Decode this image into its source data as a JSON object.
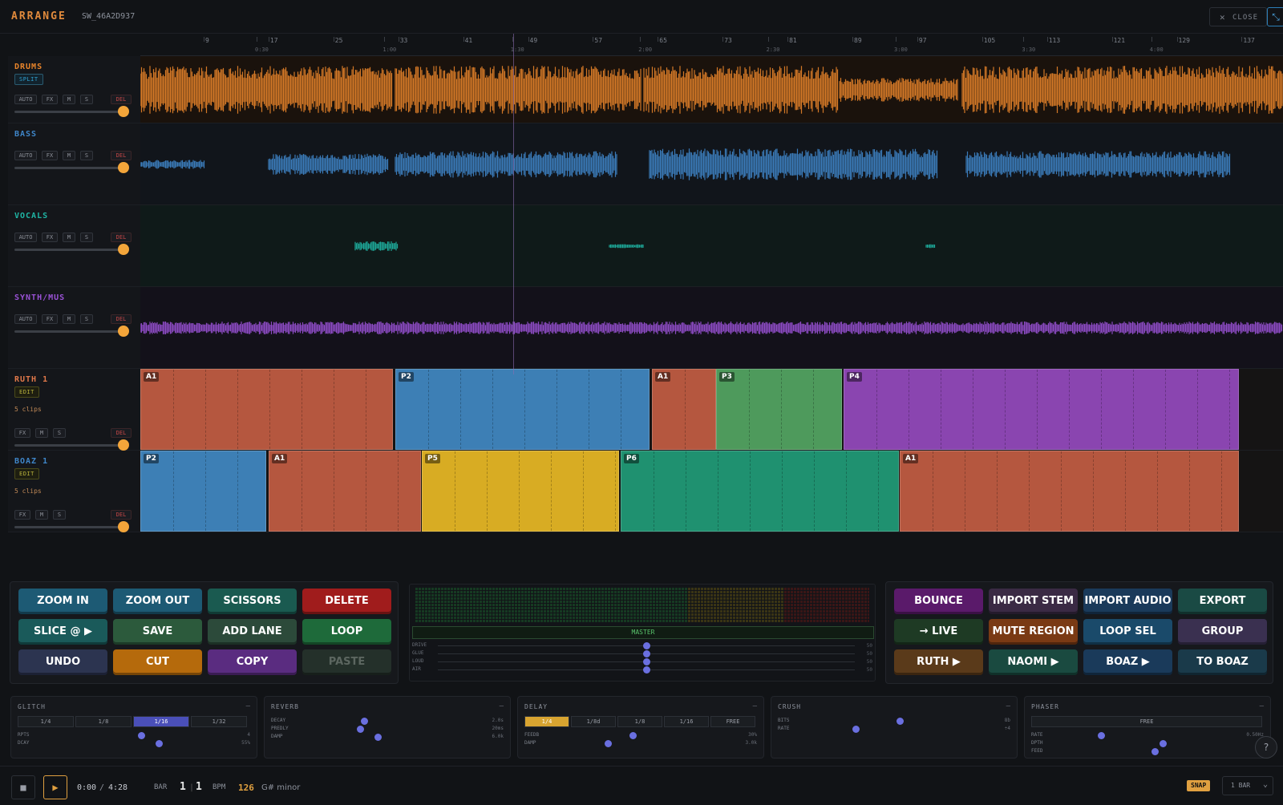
{
  "app": {
    "title": "ARRANGE",
    "session_id": "SW_46A2D937",
    "close_label": "CLOSE"
  },
  "ruler": {
    "bars": [
      "9",
      "17",
      "25",
      "33",
      "41",
      "49",
      "57",
      "65",
      "73",
      "81",
      "89",
      "97",
      "105",
      "113",
      "121",
      "129",
      "137"
    ],
    "times": [
      "0:30",
      "1:00",
      "1:30",
      "2:00",
      "2:30",
      "3:00",
      "3:30",
      "4:00"
    ]
  },
  "tracks": [
    {
      "name": "DRUMS",
      "color": "#e8842a",
      "chip": "SPLIT",
      "controls": [
        "AUTO",
        "FX",
        "M",
        "S",
        "DEL"
      ]
    },
    {
      "name": "BASS",
      "color": "#3f86c9",
      "controls": [
        "AUTO",
        "FX",
        "M",
        "S",
        "DEL"
      ]
    },
    {
      "name": "VOCALS",
      "color": "#1fb5a4",
      "controls": [
        "AUTO",
        "FX",
        "M",
        "S",
        "DEL"
      ]
    },
    {
      "name": "SYNTH/MUS",
      "color": "#9a52d6",
      "controls": [
        "AUTO",
        "FX",
        "M",
        "S",
        "DEL"
      ]
    },
    {
      "name": "RUTH 1",
      "color": "#e0784a",
      "chip": "EDIT",
      "clips": "5 clips",
      "controls": [
        "FX",
        "M",
        "S",
        "DEL"
      ],
      "regions": [
        {
          "label": "A1",
          "color": "#b5573f"
        },
        {
          "label": "P2",
          "color": "#3d7fb5"
        },
        {
          "label": "A1",
          "color": "#b5573f"
        },
        {
          "label": "P3",
          "color": "#4e9a5c"
        },
        {
          "label": "P4",
          "color": "#8a45b0"
        }
      ]
    },
    {
      "name": "BOAZ 1",
      "color": "#3f86c9",
      "chip": "EDIT",
      "clips": "5 clips",
      "controls": [
        "FX",
        "M",
        "S",
        "DEL"
      ],
      "regions": [
        {
          "label": "P2",
          "color": "#3d7fb5"
        },
        {
          "label": "A1",
          "color": "#b5573f"
        },
        {
          "label": "P5",
          "color": "#d8ac23"
        },
        {
          "label": "P6",
          "color": "#1f9170"
        },
        {
          "label": "A1",
          "color": "#b5573f"
        }
      ]
    }
  ],
  "left_buttons": [
    {
      "label": "ZOOM IN",
      "key": "q",
      "color": "#1d5a74"
    },
    {
      "label": "ZOOM OUT",
      "key": "w",
      "color": "#1d5a74"
    },
    {
      "label": "SCISSORS",
      "key": "e",
      "color": "#1a5a50"
    },
    {
      "label": "DELETE",
      "key": "z",
      "color": "#a01c1c"
    },
    {
      "label": "SLICE @ ▶",
      "key": "a",
      "color": "#1a5a5a"
    },
    {
      "label": "SAVE",
      "key": "s",
      "color": "#2c5a3c"
    },
    {
      "label": "ADD LANE",
      "key": "d",
      "color": "#2c4a3a"
    },
    {
      "label": "LOOP",
      "key": "f",
      "color": "#1e6a3a"
    },
    {
      "label": "UNDO",
      "key": "z",
      "color": "#2c3450"
    },
    {
      "label": "CUT",
      "key": "x",
      "color": "#b56a0c"
    },
    {
      "label": "COPY",
      "key": "c",
      "color": "#5a2c80"
    },
    {
      "label": "PASTE",
      "key": "v",
      "color": "#24302a",
      "disabled": true
    }
  ],
  "right_buttons": [
    {
      "label": "BOUNCE",
      "key": "b",
      "color": "#5a1a6a"
    },
    {
      "label": "IMPORT STEM",
      "key": "i",
      "color": "#3a2a44"
    },
    {
      "label": "IMPORT AUDIO",
      "key": "o",
      "color": "#1a3a5a"
    },
    {
      "label": "EXPORT",
      "key": "p",
      "color": "#1a4a44"
    },
    {
      "label": "→ LIVE",
      "key": "j",
      "color": "#1e3a24"
    },
    {
      "label": "MUTE REGION",
      "key": "k",
      "color": "#7a3a14"
    },
    {
      "label": "LOOP SEL",
      "key": "l",
      "color": "#1a4a6a"
    },
    {
      "label": "GROUP",
      "key": ";",
      "color": "#3a3050"
    },
    {
      "label": "RUTH ▶",
      "key": "n",
      "color": "#5a3a1a"
    },
    {
      "label": "NAOMI ▶",
      "key": "m",
      "color": "#1a4a40"
    },
    {
      "label": "BOAZ ▶",
      "key": ",",
      "color": "#1a3a5a"
    },
    {
      "label": "TO BOAZ",
      "key": ".",
      "color": "#1a3a4a"
    }
  ],
  "master": {
    "label": "MASTER",
    "params": [
      {
        "name": "DRIVE",
        "value": "50"
      },
      {
        "name": "GLUE",
        "value": "50"
      },
      {
        "name": "LOUD",
        "value": "50"
      },
      {
        "name": "AIR",
        "value": "50"
      }
    ]
  },
  "fx_panels": [
    {
      "name": "GLITCH",
      "segments": [
        "1/4",
        "1/8",
        "1/16",
        "1/32"
      ],
      "active": 2,
      "params": [
        {
          "name": "RPTS",
          "value": "4",
          "level": 0.46
        },
        {
          "name": "DCAY",
          "value": "55%",
          "level": 0.55
        }
      ]
    },
    {
      "name": "REVERB",
      "segments": [],
      "params": [
        {
          "name": "DECAY",
          "value": "2.0s",
          "level": 0.3
        },
        {
          "name": "PREDLY",
          "value": "20ms",
          "level": 0.28
        },
        {
          "name": "DAMP",
          "value": "6.0k",
          "level": 0.37
        }
      ]
    },
    {
      "name": "DELAY",
      "segments": [
        "1/4",
        "1/8d",
        "1/8",
        "1/16",
        "FREE"
      ],
      "active": 0,
      "params": [
        {
          "name": "FEEDB",
          "value": "30%",
          "level": 0.38
        },
        {
          "name": "DAMP",
          "value": "3.0k",
          "level": 0.25
        }
      ]
    },
    {
      "name": "CRUSH",
      "segments": [],
      "params": [
        {
          "name": "BITS",
          "value": "8b",
          "level": 0.45
        },
        {
          "name": "RATE",
          "value": "÷4",
          "level": 0.22
        }
      ]
    },
    {
      "name": "PHASER",
      "segments": [
        "FREE"
      ],
      "active": -1,
      "params": [
        {
          "name": "RATE",
          "value": "0.50Hz",
          "level": 0.18
        },
        {
          "name": "DPTH",
          "value": "",
          "level": 0.5
        },
        {
          "name": "FEED",
          "value": "",
          "level": 0.46
        }
      ]
    }
  ],
  "transport": {
    "time": "0:00",
    "duration": "4:28",
    "bar_label": "BAR",
    "bar": "1",
    "beat": "1",
    "bpm_label": "BPM",
    "bpm": "126",
    "key": "G# minor",
    "snap": "SNAP",
    "quantize": "1 BAR"
  }
}
